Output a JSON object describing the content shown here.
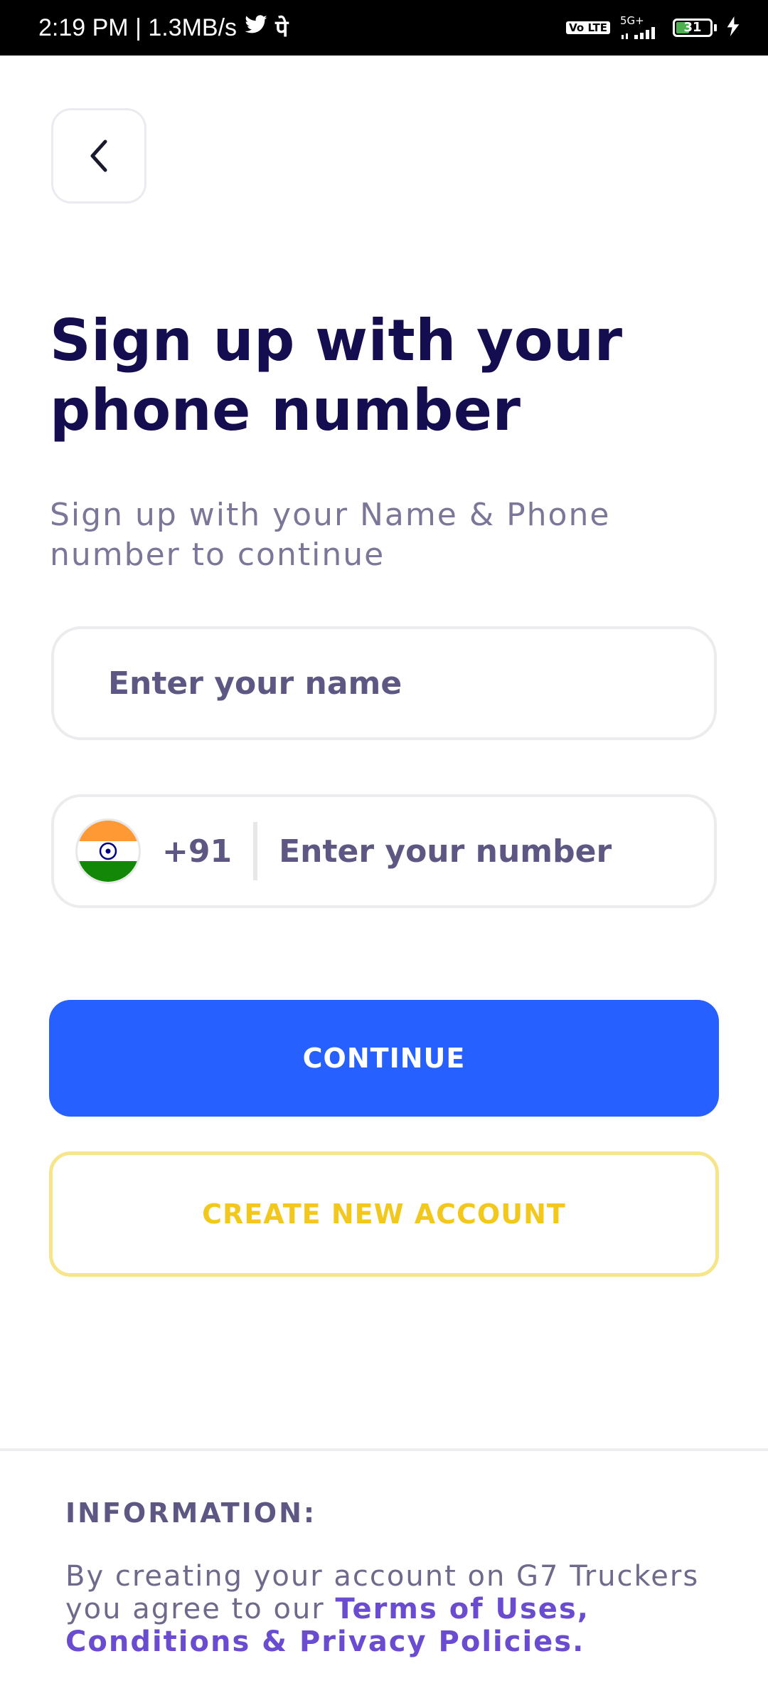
{
  "status_bar": {
    "time_speed": "2:19 PM | 1.3MB/s",
    "volte": "Vo LTE",
    "network": "5G+",
    "battery": "31",
    "colors": {
      "battery_fill": "#4caf50"
    },
    "icons": [
      "twitter-icon",
      "phonepe-icon",
      "signal-icon",
      "charging-icon"
    ]
  },
  "back_button": {
    "icon": "chevron-left-icon"
  },
  "title": "Sign up with your phone number",
  "subtitle": "Sign up with your Name & Phone number to continue",
  "name_field": {
    "placeholder": "Enter your name",
    "value": ""
  },
  "phone_field": {
    "flag": "india-flag-icon",
    "country_code": "+91",
    "placeholder": "Enter your number",
    "value": ""
  },
  "buttons": {
    "continue": "CONTINUE",
    "create_account": "CREATE NEW ACCOUNT"
  },
  "information": {
    "heading": "INFORMATION:",
    "text": "By creating your account on G7 Truckers you agree to our ",
    "link": "Terms of Uses, Conditions & Privacy Policies."
  },
  "colors": {
    "title": "#140d4f",
    "primary_button": "#2660ff",
    "secondary_button_border": "#f7e58b",
    "secondary_button_text": "#f2c81f",
    "link": "#6a4cd0"
  }
}
